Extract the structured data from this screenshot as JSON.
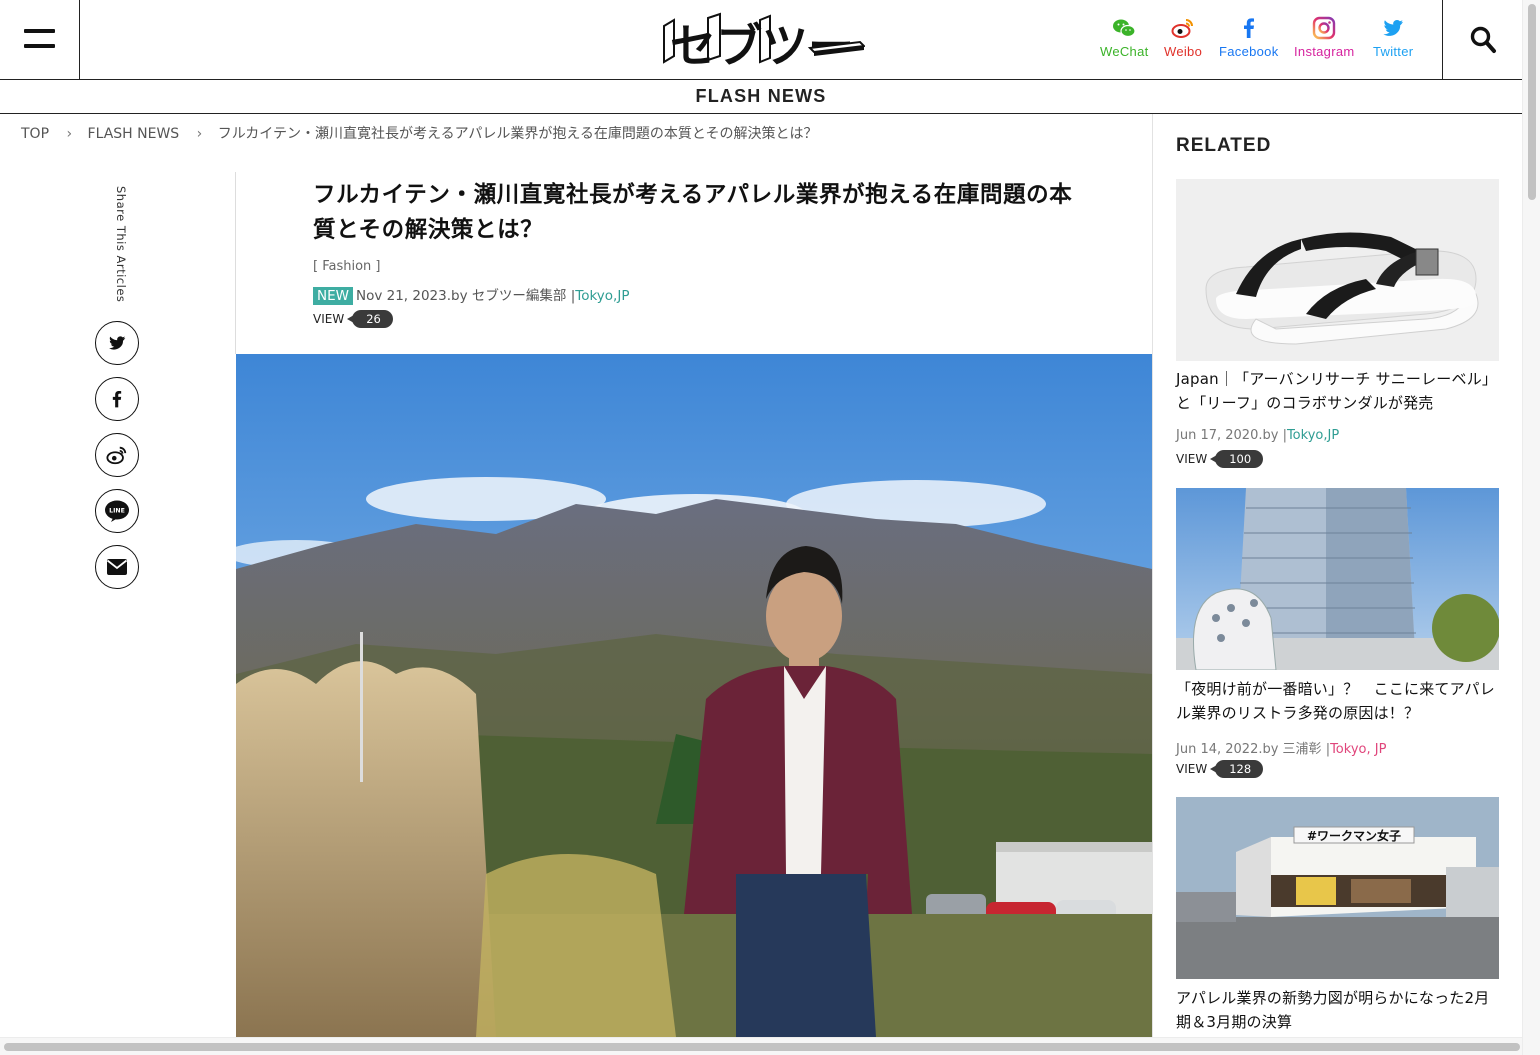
{
  "header": {
    "logo_text": "セブツー",
    "social": [
      {
        "label": "WeChat",
        "icon": "wechat-icon",
        "color": "#3bb329"
      },
      {
        "label": "Weibo",
        "icon": "weibo-icon",
        "color": "#e0322b"
      },
      {
        "label": "Facebook",
        "icon": "facebook-icon",
        "color": "#1877f2"
      },
      {
        "label": "Instagram",
        "icon": "instagram-icon",
        "color": "#d6249f"
      },
      {
        "label": "Twitter",
        "icon": "twitter-icon",
        "color": "#1da1f2"
      }
    ]
  },
  "section_title": "FLASH NEWS",
  "breadcrumb": {
    "items": [
      "TOP",
      "FLASH NEWS",
      "フルカイテン・瀬川直寛社長が考えるアパレル業界が抱える在庫問題の本質とその解決策とは？"
    ]
  },
  "share": {
    "label": "Share This Articles",
    "icons": [
      "twitter-icon",
      "facebook-icon",
      "weibo-icon",
      "line-icon",
      "mail-icon"
    ],
    "line_text": "LINE"
  },
  "article": {
    "title": "フルカイテン・瀬川直寛社長が考えるアパレル業界が抱える在庫問題の本質とその解決策とは？",
    "category": "[ Fashion ]",
    "badge": "NEW",
    "date_author": "Nov 21, 2023.by セブツー編集部",
    "separator": "|",
    "location": "Tokyo,JP",
    "view_label": "VIEW",
    "view_count": "26"
  },
  "related": {
    "heading": "RELATED",
    "items": [
      {
        "title": "Japan｜「アーバンリサーチ サニーレーベル」と「リーフ」のコラボサンダルが発売",
        "date_author": "Jun 17, 2020.by",
        "separator": "|",
        "location": "Tokyo,JP",
        "location_color": "#2f9d93",
        "view_label": "VIEW",
        "view_count": "100"
      },
      {
        "title": "「夜明け前が一番暗い」？　ここに来てアパレル業界のリストラ多発の原因は！？",
        "date_author": "Jun 14, 2022.by 三浦彰",
        "separator": "|",
        "location": "Tokyo, JP",
        "location_color": "#e0457b",
        "view_label": "VIEW",
        "view_count": "128"
      },
      {
        "title": "アパレル業界の新勢力図が明らかになった2月期＆3月期の決算",
        "sign_text": "#ワークマン女子"
      }
    ]
  }
}
